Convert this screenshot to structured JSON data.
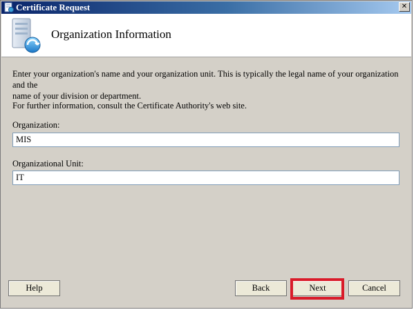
{
  "window": {
    "title": "Certificate Request",
    "close_glyph": "✕"
  },
  "header": {
    "title": "Organization Information",
    "icon": "certificate-icon"
  },
  "body": {
    "intro_line1": "Enter your organization's name and your organization unit. This is typically the legal name of your organization and the",
    "intro_line2": "name of your division or department.",
    "further_info": "For further information, consult the Certificate Authority's web site."
  },
  "form": {
    "organization_label": "Organization:",
    "organization_value": "MIS",
    "unit_label": "Organizational Unit:",
    "unit_value": "IT"
  },
  "buttons": {
    "help": "Help",
    "back": "Back",
    "next": "Next",
    "cancel": "Cancel"
  },
  "colors": {
    "highlight": "#d91b2a",
    "title_bar": "#0a246a"
  }
}
